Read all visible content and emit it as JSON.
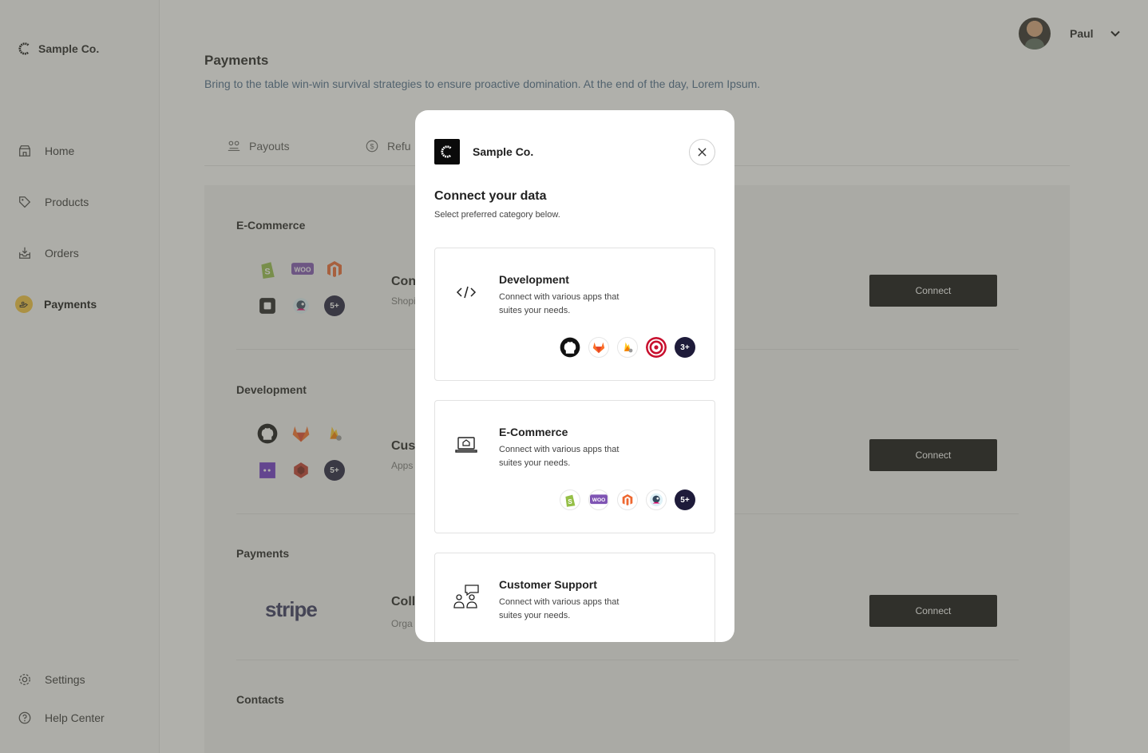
{
  "brand": {
    "name": "Sample Co."
  },
  "sidebar": {
    "items": [
      {
        "label": "Home",
        "icon": "store-icon"
      },
      {
        "label": "Products",
        "icon": "tag-icon"
      },
      {
        "label": "Orders",
        "icon": "inbox-icon"
      },
      {
        "label": "Payments",
        "icon": "payments-icon",
        "active": true
      }
    ],
    "bottom": [
      {
        "label": "Settings",
        "icon": "gear-icon"
      },
      {
        "label": "Help Center",
        "icon": "help-icon"
      }
    ]
  },
  "header": {
    "user_name": "Paul"
  },
  "page": {
    "title": "Payments",
    "subtitle": "Bring to the table win-win survival strategies to ensure proactive domination. At the end of the day, Lorem Ipsum."
  },
  "tabs": [
    {
      "label": "Payouts",
      "icon": "payouts-icon"
    },
    {
      "label": "Refu",
      "icon": "refund-icon"
    }
  ],
  "sections": [
    {
      "title": "E-Commerce",
      "row_title": "Con",
      "row_sub": "Shopi",
      "more": "5+",
      "button": "Connect"
    },
    {
      "title": "Development",
      "row_title": "Cust",
      "row_sub": "Apps",
      "more": "5+",
      "button": "Connect"
    },
    {
      "title": "Payments",
      "row_title": "Coll",
      "row_sub": "Orga",
      "logo": "stripe",
      "button": "Connect"
    },
    {
      "title": "Contacts"
    }
  ],
  "modal": {
    "brand": "Sample Co.",
    "title": "Connect your data",
    "subtitle": "Select preferred category below.",
    "cards": [
      {
        "title": "Development",
        "desc": "Connect with various apps that suites your needs.",
        "icon": "code-icon",
        "apps": [
          "github",
          "gitlab",
          "firebase",
          "target"
        ],
        "more": "3+"
      },
      {
        "title": "E-Commerce",
        "desc": "Connect with various apps that suites your needs.",
        "icon": "laptop-store-icon",
        "apps": [
          "shopify",
          "woo",
          "magento",
          "prestashop"
        ],
        "more": "5+"
      },
      {
        "title": "Customer Support",
        "desc": "Connect with various apps that suites your needs.",
        "icon": "support-icon"
      }
    ]
  },
  "colors": {
    "accent": "#f5c33b",
    "button": "#0a0a0a",
    "badge": "#1e1b3a",
    "overlay": "rgba(90,90,80,0.48)"
  }
}
